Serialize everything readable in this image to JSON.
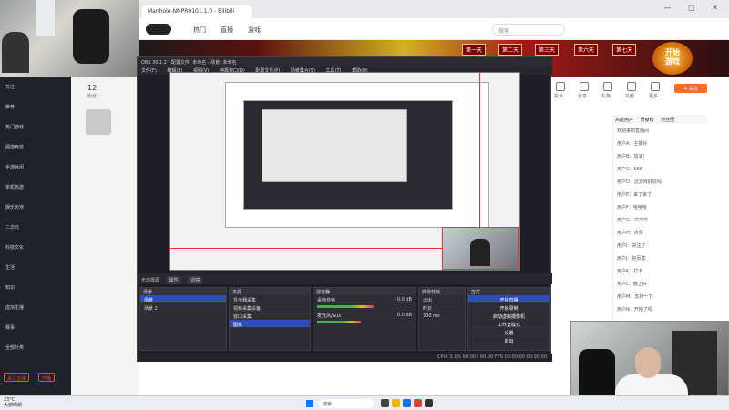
{
  "browser": {
    "tab_title": "Manhole-NNPR0101.1.0 - Bilibili",
    "window_controls": "— ▢ ✕",
    "nav": [
      "热门",
      "直播",
      "游戏"
    ],
    "search_placeholder": "搜索"
  },
  "banner": {
    "days": [
      "第一天",
      "第二天",
      "第三天",
      "第六天",
      "第七天"
    ],
    "cta_line1": "开始",
    "cta_line2": "游戏"
  },
  "sidebar": {
    "items": [
      "关注",
      "推荐",
      "热门游戏",
      "网游竞技",
      "手游休闲",
      "单机热游",
      "娱乐天地",
      "二次元",
      "科技文化",
      "生活",
      "知识",
      "虚拟主播",
      "赛事",
      "全部分类"
    ],
    "buttons": [
      "关注主播",
      "开播"
    ]
  },
  "streamer": {
    "fans": "12",
    "fans_label": "粉丝"
  },
  "obs": {
    "title": "OBS 30.1.2 - 配置文件: 未命名 - 场景: 未命名",
    "menu": [
      "文件(F)",
      "编辑(E)",
      "视图(V)",
      "停靠窗口(D)",
      "配置文件(P)",
      "场景集合(S)",
      "工具(T)",
      "帮助(H)"
    ],
    "dock_header": "无选择源",
    "dock_buttons": [
      "属性",
      "滤镜"
    ],
    "scenes_title": "场景",
    "scenes": [
      "场景",
      "场景 2"
    ],
    "sources_title": "来源",
    "sources": [
      "显示器采集",
      "视频采集设备",
      "窗口采集",
      "图像"
    ],
    "mixer_title": "混音器",
    "mixer": [
      {
        "name": "桌面音频",
        "db": "0.0 dB",
        "level": 0.62
      },
      {
        "name": "麦克风/Aux",
        "db": "0.0 dB",
        "level": 0.48
      }
    ],
    "transitions_title": "转场特效",
    "transition_type": "淡出",
    "transition_duration_label": "时长",
    "transition_duration": "300 ms",
    "controls_title": "控件",
    "controls": [
      "开始直播",
      "开始录制",
      "启动虚拟摄像机",
      "工作室模式",
      "设置",
      "退出"
    ],
    "status": "CPU: 3.1%   60.00 / 60.00 FPS   00:00:00   00:00:00"
  },
  "chat": {
    "tabs": [
      "高能用户",
      "贡献榜",
      "粉丝团"
    ],
    "lines": [
      "欢迎来到直播间",
      "用户A：主播好",
      "用户B：加油！",
      "用户C：666",
      "用户D：这游戏好玩吗",
      "用户E：来了来了",
      "用户F：哈哈哈",
      "用户G：冲冲冲",
      "用户H：点赞",
      "用户I：关注了",
      "用户J：好厉害",
      "用户K：打卡",
      "用户L：晚上好",
      "用户M：支持一下",
      "用户N：开始了吗"
    ]
  },
  "icons_row": [
    "投诉",
    "分享",
    "礼物",
    "充值",
    "更多"
  ],
  "subscribe_label": "+ 关注",
  "taskbar": {
    "search": "搜索",
    "weather_temp": "23°C",
    "weather_desc": "大部晴朗"
  },
  "colors": {
    "obs_bg": "#1e1f26",
    "selection_blue": "#2d4fb5",
    "accent_orange": "#ff6a2b",
    "guide_red": "#e33333"
  }
}
